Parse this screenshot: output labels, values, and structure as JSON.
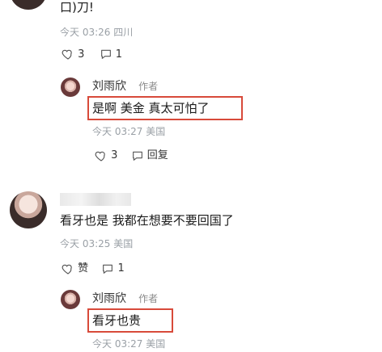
{
  "top_comment": {
    "content_partial": "口)刀!",
    "time": "今天 03:26",
    "location": "四川",
    "likes": "3",
    "replies": "1"
  },
  "reply1": {
    "author": "刘雨欣",
    "author_tag": "作者",
    "content": "是啊 美金 真太可怕了",
    "time": "今天 03:27",
    "location": "美国",
    "likes": "3",
    "reply_label": "回复"
  },
  "comment2": {
    "content": "看牙也是 我都在想要不要回国了",
    "time": "今天 03:25",
    "location": "美国",
    "like_label": "赞",
    "replies": "1"
  },
  "reply2": {
    "author": "刘雨欣",
    "author_tag": "作者",
    "content": "看牙也贵",
    "time_partial": "今天 03:27",
    "location_partial": "美国"
  },
  "colors": {
    "highlight_border": "#d84a3a",
    "meta_text": "#9aa0a6"
  },
  "icons": [
    "heart-icon",
    "comment-bubble-icon"
  ]
}
